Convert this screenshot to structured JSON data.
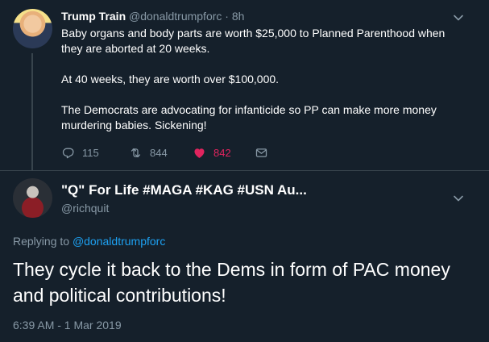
{
  "original_tweet": {
    "display_name": "Trump Train",
    "handle": "@donaldtrumpforc",
    "separator": "·",
    "time_ago": "8h",
    "paragraphs": [
      "Baby organs and body parts are worth $25,000 to Planned Parenthood when they are aborted at 20 weeks.",
      "At 40 weeks, they are worth over $100,000.",
      "The Democrats are advocating for infanticide so PP can make more money murdering babies. Sickening!"
    ],
    "reply_count": "115",
    "retweet_count": "844",
    "like_count": "842",
    "liked": true
  },
  "reply_tweet": {
    "display_name": "\"Q\" For Life #MAGA #KAG #USN Au...",
    "handle": "@richquit",
    "replying_prefix": "Replying to",
    "replying_to": "@donaldtrumpforc",
    "text": "They cycle it back to the Dems in form of PAC money and political contributions!",
    "timestamp": "6:39 AM - 1 Mar 2019"
  },
  "colors": {
    "background": "#15202b",
    "secondary_text": "#8899a6",
    "link": "#1da1f2",
    "like": "#e0245e",
    "divider": "#38444d"
  },
  "icons": [
    "chevron-down-icon",
    "reply-icon",
    "retweet-icon",
    "heart-icon",
    "dm-icon"
  ]
}
